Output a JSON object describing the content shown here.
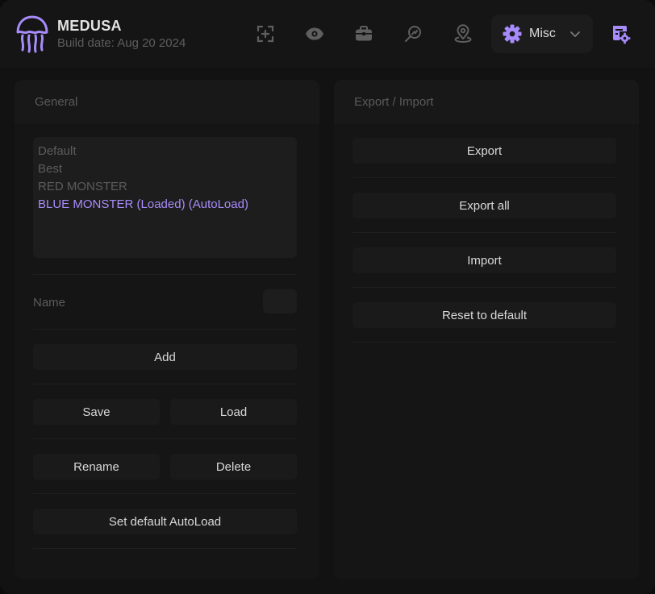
{
  "app": {
    "title": "MEDUSA",
    "build_date": "Build date: Aug 20 2024"
  },
  "nav": {
    "icons": [
      "crosshair-icon",
      "eye-icon",
      "briefcase-icon",
      "search-magnifier-icon",
      "map-pin-icon"
    ],
    "misc_label": "Misc",
    "accent": "#a78bfa"
  },
  "general": {
    "title": "General",
    "configs": [
      "Default",
      "Best",
      "RED MONSTER",
      "BLUE MONSTER (Loaded) (AutoLoad)"
    ],
    "active_index": 3,
    "name_label": "Name",
    "name_value": "",
    "add_label": "Add",
    "save_label": "Save",
    "load_label": "Load",
    "rename_label": "Rename",
    "delete_label": "Delete",
    "autoload_label": "Set default AutoLoad"
  },
  "export_import": {
    "title": "Export / Import",
    "export_label": "Export",
    "export_all_label": "Export all",
    "import_label": "Import",
    "reset_label": "Reset to default"
  }
}
